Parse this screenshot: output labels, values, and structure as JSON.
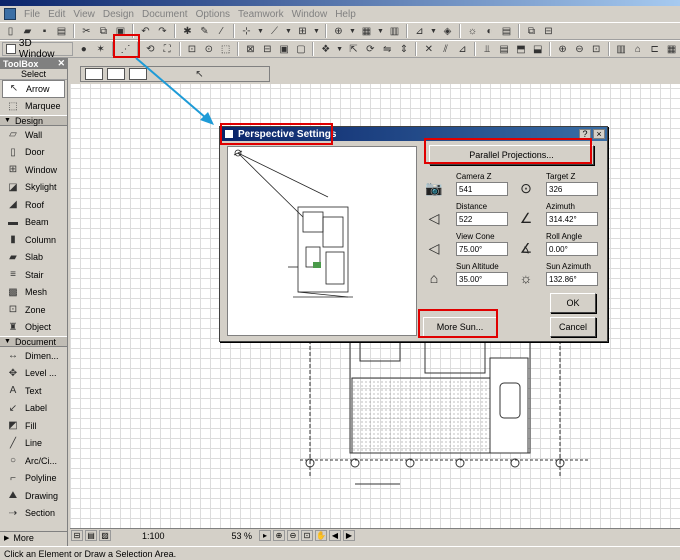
{
  "menu": [
    "File",
    "Edit",
    "View",
    "Design",
    "Document",
    "Options",
    "Teamwork",
    "Window",
    "Help"
  ],
  "toolbar": {
    "window3d_label": "3D Window"
  },
  "toolbox": {
    "title": "ToolBox",
    "select_label": "Select",
    "arrow_tool": "Arrow",
    "marquee_tool": "Marquee",
    "design_section": "Design",
    "design_tools": [
      "Wall",
      "Door",
      "Window",
      "Skylight",
      "Roof",
      "Beam",
      "Column",
      "Slab",
      "Stair",
      "Mesh",
      "Zone",
      "Object"
    ],
    "document_section": "Document",
    "document_tools": [
      "Dimen...",
      "Level ...",
      "Text",
      "Label",
      "Fill",
      "Line",
      "Arc/Ci...",
      "Polyline",
      "Drawing",
      "Section"
    ],
    "more_label": "More"
  },
  "navbar": {
    "scale": "1:100",
    "zoom": "53 %"
  },
  "status": {
    "text": "Click an Element or Draw a Selection Area."
  },
  "dialog": {
    "title": "Perspective Settings",
    "help_btn": "?",
    "close_btn": "×",
    "parallel_projections": "Parallel Projections...",
    "camera_z_label": "Camera Z",
    "camera_z_value": "541",
    "target_z_label": "Target Z",
    "target_z_value": "326",
    "distance_label": "Distance",
    "distance_value": "522",
    "azimuth_label": "Azimuth",
    "azimuth_value": "314.42°",
    "view_cone_label": "View Cone",
    "view_cone_value": "75.00°",
    "roll_angle_label": "Roll Angle",
    "roll_angle_value": "0.00°",
    "sun_altitude_label": "Sun Altitude",
    "sun_altitude_value": "35.00°",
    "sun_azimuth_label": "Sun Azimuth",
    "sun_azimuth_value": "132.86°",
    "ok": "OK",
    "cancel": "Cancel",
    "more_sun": "More Sun..."
  },
  "colors": {
    "highlight": "#e00000",
    "arrow": "#1e9bd7",
    "titlebar": "#0a246a"
  }
}
